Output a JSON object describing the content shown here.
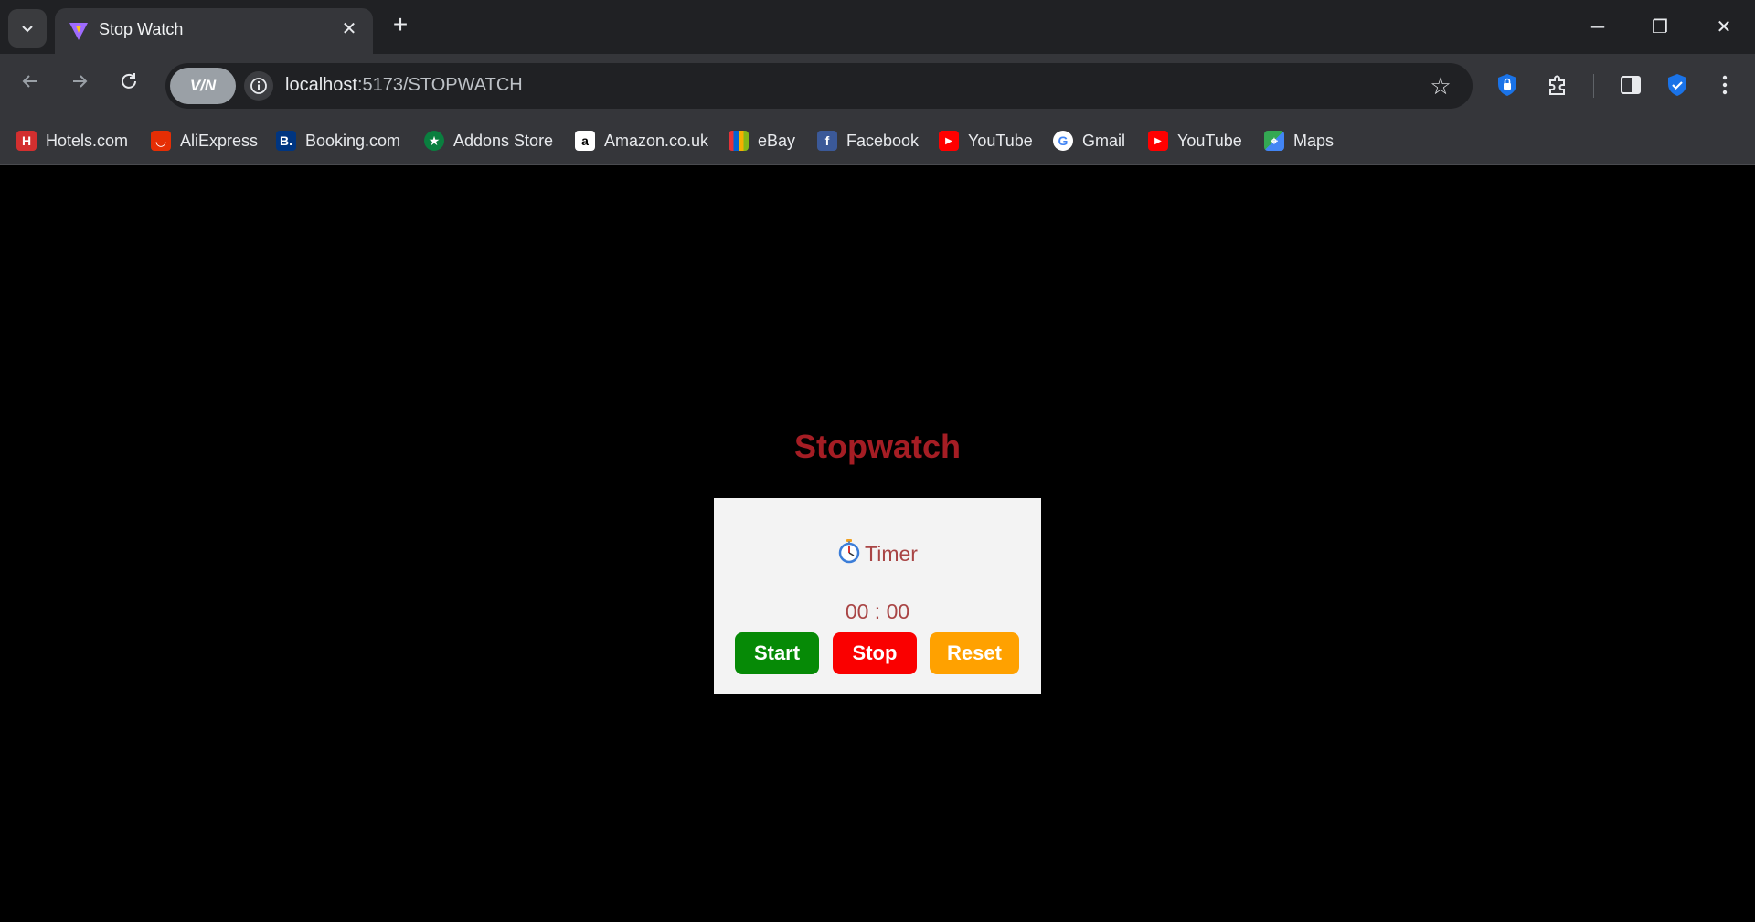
{
  "browser": {
    "tab_title": "Stop Watch",
    "url_host": "localhost",
    "url_rest": ":5173/STOPWATCH",
    "vpn_label": "V/N",
    "bookmarks": [
      {
        "label": "Hotels.com",
        "icon": "hotels-icon",
        "color": "#d32f2f"
      },
      {
        "label": "AliExpress",
        "icon": "aliexpress-icon",
        "color": "#e62e04"
      },
      {
        "label": "Booking.com",
        "icon": "booking-icon",
        "color": "#003580"
      },
      {
        "label": "Addons Store",
        "icon": "addons-store-icon",
        "color": "#0a7f3f"
      },
      {
        "label": "Amazon.co.uk",
        "icon": "amazon-icon",
        "color": "#ffffff"
      },
      {
        "label": "eBay",
        "icon": "ebay-icon",
        "color": "#444444"
      },
      {
        "label": "Facebook",
        "icon": "facebook-icon",
        "color": "#3b5998"
      },
      {
        "label": "YouTube",
        "icon": "youtube-icon",
        "color": "#ff0000"
      },
      {
        "label": "Gmail",
        "icon": "google-icon",
        "color": "#ffffff"
      },
      {
        "label": "YouTube",
        "icon": "youtube-icon",
        "color": "#ff0000"
      },
      {
        "label": "Maps",
        "icon": "maps-icon",
        "color": "#34a853"
      }
    ]
  },
  "page": {
    "title": "Stopwatch",
    "timer_label": "Timer",
    "time_display": "00 : 00",
    "buttons": {
      "start": "Start",
      "stop": "Stop",
      "reset": "Reset"
    },
    "colors": {
      "title": "#a51d24",
      "start": "#068a06",
      "stop": "#fa0000",
      "reset": "#ffa100",
      "card_bg": "#f3f3f3"
    }
  }
}
